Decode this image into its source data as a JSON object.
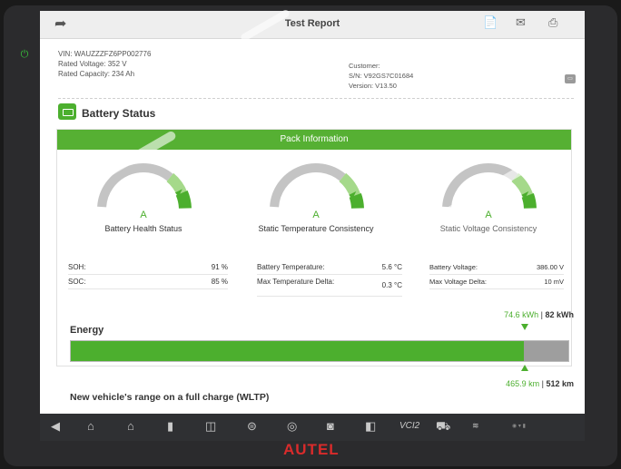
{
  "header": {
    "title": "Test Report",
    "back_icon": "back-arrow-icon",
    "icons": [
      "pdf-icon",
      "mail-icon",
      "print-icon"
    ]
  },
  "vehicle": {
    "vin": "VIN: WAUZZZFZ6PP002776",
    "voltage": "Rated Voltage: 352 V",
    "capacity": "Rated Capacity: 234 Ah"
  },
  "device": {
    "customer": "Customer:",
    "sn": "S/N: V92GS7C01684",
    "version": "Version: V13.50"
  },
  "section": {
    "title": "Battery Status"
  },
  "pack": {
    "header": "Pack Information",
    "gauges": [
      {
        "grade": "A",
        "label": "Battery Health Status",
        "level": 0.88
      },
      {
        "grade": "A",
        "label": "Static Temperature Consistency",
        "level": 0.9
      },
      {
        "grade": "A",
        "label": "Static Voltage Consistency",
        "level": 0.9
      }
    ],
    "col1": [
      {
        "label": "SOH:",
        "value": "91 %"
      },
      {
        "label": "SOC:",
        "value": "85 %"
      }
    ],
    "col2": [
      {
        "label": "Battery Temperature:",
        "value": "5.6 °C"
      },
      {
        "label": "Max Temperature Delta:",
        "value": "0.3 °C"
      }
    ],
    "col3": [
      {
        "label": "Battery Voltage:",
        "value": "386.00 V"
      },
      {
        "label": "Max Voltage Delta:",
        "value": "10 mV"
      }
    ]
  },
  "energy": {
    "title": "Energy",
    "current": "74.6 kWh",
    "total": "82 kWh",
    "fill_fraction": 0.91,
    "range_title": "New vehicle's range on a full charge (WLTP)",
    "range_current": "465.9 km",
    "range_total": "512 km"
  },
  "brand": "AUTEL",
  "colors": {
    "accent": "#56b033",
    "bar": "#4caf2e",
    "track": "#9e9e9e",
    "brand": "#d92b2b"
  }
}
